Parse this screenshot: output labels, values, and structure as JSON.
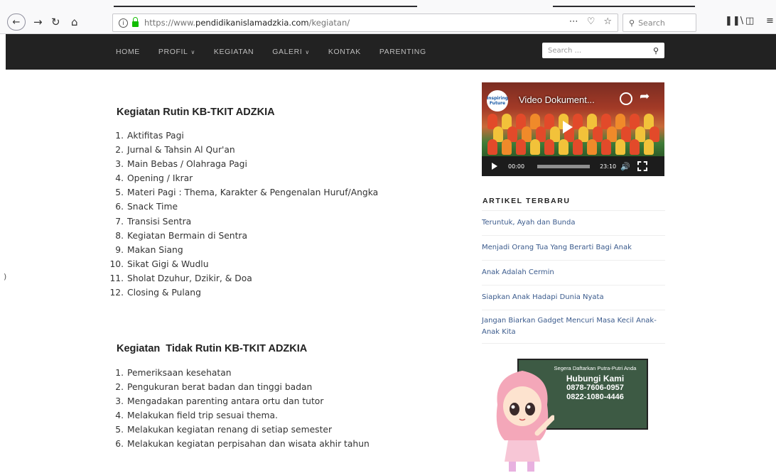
{
  "browser": {
    "url_prefix": "https://www.",
    "url_domain": "pendidikanislamadzkia.com",
    "url_path": "/kegiatan/",
    "search_placeholder": "Search",
    "icons": [
      "back-icon",
      "forward-icon",
      "reload-icon",
      "home-icon",
      "info-icon",
      "lock-icon",
      "more-icon",
      "pocket-icon",
      "bookmark-star-icon",
      "library-icon",
      "sidebar-icon",
      "menu-icon"
    ]
  },
  "nav": {
    "items": [
      {
        "label": "HOME",
        "dropdown": false
      },
      {
        "label": "PROFIL",
        "dropdown": true
      },
      {
        "label": "KEGIATAN",
        "dropdown": false
      },
      {
        "label": "GALERI",
        "dropdown": true
      },
      {
        "label": "KONTAK",
        "dropdown": false
      },
      {
        "label": "PARENTING",
        "dropdown": false
      }
    ],
    "search_placeholder": "Search ..."
  },
  "content": {
    "rutin": {
      "title": "Kegiatan Rutin KB-TKIT ADZKIA",
      "items": [
        "Aktifitas Pagi",
        "Jurnal & Tahsin Al Qur'an",
        "Main Bebas / Olahraga Pagi",
        "Opening / Ikrar",
        "Materi Pagi : Thema, Karakter & Pengenalan Huruf/Angka",
        "Snack Time",
        "Transisi Sentra",
        "Kegiatan Bermain di Sentra",
        "Makan Siang",
        "Sikat Gigi & Wudlu",
        "Sholat Dzuhur, Dzikir, & Doa",
        "Closing & Pulang"
      ]
    },
    "tidak_rutin": {
      "title": "Kegiatan  Tidak Rutin KB-TKIT ADZKIA",
      "items": [
        "Pemeriksaan kesehatan",
        "Pengukuran berat badan dan tinggi badan",
        "Mengadakan parenting antara ortu dan tutor",
        "Melakukan field trip sesuai thema.",
        "Melakukan kegiatan renang di setiap semester",
        "Melakukan kegiatan perpisahan dan wisata akhir tahun"
      ]
    }
  },
  "video": {
    "title": "Video Dokument...",
    "logo_text": "Inspiring Future",
    "current_time": "00:00",
    "duration": "23:10"
  },
  "sidebar": {
    "heading": "ARTIKEL TERBARU",
    "articles": [
      "Teruntuk, Ayah dan Bunda",
      "Menjadi Orang Tua Yang Berarti Bagi Anak",
      "Anak Adalah Cermin",
      "Siapkan Anak Hadapi Dunia Nyata",
      "Jangan Biarkan Gadget Mencuri Masa Kecil Anak-Anak Kita"
    ],
    "banner": {
      "line1": "Segera Daftarkan Putra-Putri Anda",
      "line2": "Hubungi Kami",
      "phone1": "0878-7606-0957",
      "phone2": "0822-1080-4446"
    }
  },
  "colors": {
    "nav_bg": "#222222",
    "link": "#3a5a8c",
    "banner_bg": "#3d5a44"
  }
}
